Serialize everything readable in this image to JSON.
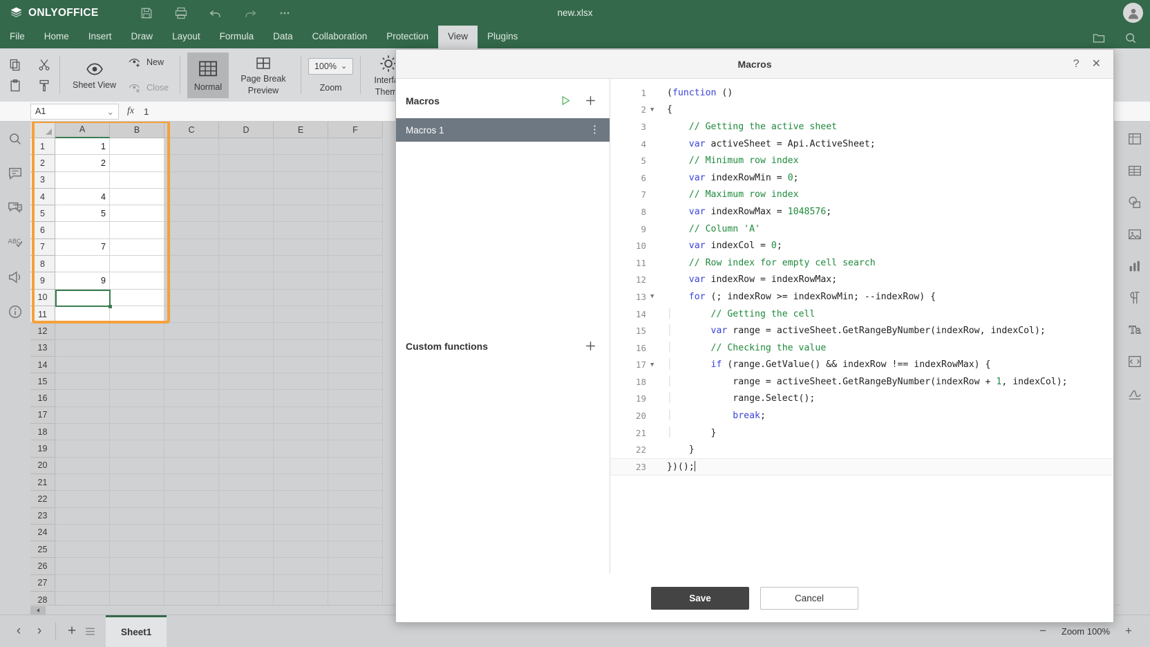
{
  "app": {
    "brand": "ONLYOFFICE",
    "document_title": "new.xlsx",
    "quick_icons": [
      "save-icon",
      "print-icon",
      "undo-icon",
      "redo-icon",
      "more-icon"
    ],
    "avatar": "user-avatar"
  },
  "tabs": [
    {
      "label": "File",
      "active": false
    },
    {
      "label": "Home",
      "active": false
    },
    {
      "label": "Insert",
      "active": false
    },
    {
      "label": "Draw",
      "active": false
    },
    {
      "label": "Layout",
      "active": false
    },
    {
      "label": "Formula",
      "active": false
    },
    {
      "label": "Data",
      "active": false
    },
    {
      "label": "Collaboration",
      "active": false
    },
    {
      "label": "Protection",
      "active": false
    },
    {
      "label": "View",
      "active": true
    },
    {
      "label": "Plugins",
      "active": false
    }
  ],
  "ribbon": {
    "clipboard": [
      "copy-icon",
      "cut-icon",
      "paste-icon",
      "format-painter-icon"
    ],
    "sheet_view": {
      "label": "Sheet View",
      "caret": "⌄"
    },
    "new_view": "New",
    "close_view": "Close",
    "normal": "Normal",
    "page_break_preview": "Page Break\nPreview",
    "page_break_line1": "Page Break",
    "page_break_line2": "Preview",
    "zoom_value": "100%",
    "zoom_caret": "⌄",
    "zoom_label": "Zoom",
    "interface_theme_line1": "Interfac",
    "interface_theme_line2": "Theme"
  },
  "formula_bar": {
    "name_box": "A1",
    "fx": "fx",
    "formula_value": "1"
  },
  "left_rail": [
    "search-icon",
    "comment-icon",
    "chat-icon",
    "spellcheck-icon",
    "feedback-icon",
    "about-icon"
  ],
  "right_rail": [
    "cell-settings-icon",
    "table-settings-icon",
    "shape-settings-icon",
    "image-settings-icon",
    "chart-settings-icon",
    "paragraph-settings-icon",
    "text-art-icon",
    "pivot-settings-icon",
    "signature-icon"
  ],
  "spreadsheet": {
    "columns": [
      "A",
      "B",
      "C",
      "D",
      "E",
      "F"
    ],
    "selected_column": "A",
    "rows": [
      {
        "num": "1",
        "A": "1",
        "B": "",
        "inbox": true
      },
      {
        "num": "2",
        "A": "2",
        "B": "",
        "inbox": true
      },
      {
        "num": "3",
        "A": "",
        "B": "",
        "inbox": true
      },
      {
        "num": "4",
        "A": "4",
        "B": "",
        "inbox": true
      },
      {
        "num": "5",
        "A": "5",
        "B": "",
        "inbox": true
      },
      {
        "num": "6",
        "A": "",
        "B": "",
        "inbox": true
      },
      {
        "num": "7",
        "A": "7",
        "B": "",
        "inbox": true
      },
      {
        "num": "8",
        "A": "",
        "B": "",
        "inbox": true
      },
      {
        "num": "9",
        "A": "9",
        "B": "",
        "inbox": true
      },
      {
        "num": "10",
        "A": "",
        "B": "",
        "inbox": true
      },
      {
        "num": "11",
        "A": "",
        "B": "",
        "inbox": true
      },
      {
        "num": "12",
        "A": "",
        "B": "",
        "inbox": false
      },
      {
        "num": "13",
        "A": "",
        "B": "",
        "inbox": false
      },
      {
        "num": "14",
        "A": "",
        "B": "",
        "inbox": false
      },
      {
        "num": "15",
        "A": "",
        "B": "",
        "inbox": false
      },
      {
        "num": "16",
        "A": "",
        "B": "",
        "inbox": false
      },
      {
        "num": "17",
        "A": "",
        "B": "",
        "inbox": false
      },
      {
        "num": "18",
        "A": "",
        "B": "",
        "inbox": false
      },
      {
        "num": "19",
        "A": "",
        "B": "",
        "inbox": false
      },
      {
        "num": "20",
        "A": "",
        "B": "",
        "inbox": false
      },
      {
        "num": "21",
        "A": "",
        "B": "",
        "inbox": false
      },
      {
        "num": "22",
        "A": "",
        "B": "",
        "inbox": false
      },
      {
        "num": "23",
        "A": "",
        "B": "",
        "inbox": false
      },
      {
        "num": "24",
        "A": "",
        "B": "",
        "inbox": false
      },
      {
        "num": "25",
        "A": "",
        "B": "",
        "inbox": false
      },
      {
        "num": "26",
        "A": "",
        "B": "",
        "inbox": false
      },
      {
        "num": "27",
        "A": "",
        "B": "",
        "inbox": false
      },
      {
        "num": "28",
        "A": "",
        "B": "",
        "inbox": false
      }
    ],
    "active_cell": "A10",
    "annotation_color": "#f5a03c"
  },
  "status_bar": {
    "prev": "‹",
    "next": "›",
    "add_sheet": "+",
    "sheet_list": "list-icon",
    "sheet_tabs": [
      {
        "label": "Sheet1",
        "active": true
      }
    ],
    "zoom_out": "−",
    "zoom_label": "Zoom 100%",
    "zoom_in": "+"
  },
  "dialog": {
    "title": "Macros",
    "help": "?",
    "close": "✕",
    "macros_panel": {
      "title": "Macros",
      "run_icon": "run-icon",
      "add_icon": "plus-icon",
      "items": [
        {
          "label": "Macros 1",
          "selected": true,
          "menu": "⋮"
        }
      ]
    },
    "custom_functions_panel": {
      "title": "Custom functions",
      "add_icon": "plus-icon"
    },
    "buttons": {
      "save": "Save",
      "cancel": "Cancel"
    },
    "code": {
      "active_line": 23,
      "lines": [
        {
          "n": "1",
          "fold": false,
          "tokens": [
            {
              "t": "(",
              "c": "p"
            },
            {
              "t": "function",
              "c": "kw"
            },
            {
              "t": " ()",
              "c": "p"
            }
          ]
        },
        {
          "n": "2",
          "fold": true,
          "tokens": [
            {
              "t": "{",
              "c": "p"
            }
          ]
        },
        {
          "n": "3",
          "fold": false,
          "tokens": [
            {
              "t": "    // Getting the active sheet",
              "c": "cm"
            }
          ]
        },
        {
          "n": "4",
          "fold": false,
          "tokens": [
            {
              "t": "    ",
              "c": "p"
            },
            {
              "t": "var",
              "c": "kw"
            },
            {
              "t": " activeSheet = Api.ActiveSheet;",
              "c": "p"
            }
          ]
        },
        {
          "n": "5",
          "fold": false,
          "tokens": [
            {
              "t": "    // Minimum row index",
              "c": "cm"
            }
          ]
        },
        {
          "n": "6",
          "fold": false,
          "tokens": [
            {
              "t": "    ",
              "c": "p"
            },
            {
              "t": "var",
              "c": "kw"
            },
            {
              "t": " indexRowMin = ",
              "c": "p"
            },
            {
              "t": "0",
              "c": "nm"
            },
            {
              "t": ";",
              "c": "p"
            }
          ]
        },
        {
          "n": "7",
          "fold": false,
          "tokens": [
            {
              "t": "    // Maximum row index",
              "c": "cm"
            }
          ]
        },
        {
          "n": "8",
          "fold": false,
          "tokens": [
            {
              "t": "    ",
              "c": "p"
            },
            {
              "t": "var",
              "c": "kw"
            },
            {
              "t": " indexRowMax = ",
              "c": "p"
            },
            {
              "t": "1048576",
              "c": "nm"
            },
            {
              "t": ";",
              "c": "p"
            }
          ]
        },
        {
          "n": "9",
          "fold": false,
          "tokens": [
            {
              "t": "    // Column 'A'",
              "c": "cm"
            }
          ]
        },
        {
          "n": "10",
          "fold": false,
          "tokens": [
            {
              "t": "    ",
              "c": "p"
            },
            {
              "t": "var",
              "c": "kw"
            },
            {
              "t": " indexCol = ",
              "c": "p"
            },
            {
              "t": "0",
              "c": "nm"
            },
            {
              "t": ";",
              "c": "p"
            }
          ]
        },
        {
          "n": "11",
          "fold": false,
          "tokens": [
            {
              "t": "    // Row index for empty cell search",
              "c": "cm"
            }
          ]
        },
        {
          "n": "12",
          "fold": false,
          "tokens": [
            {
              "t": "    ",
              "c": "p"
            },
            {
              "t": "var",
              "c": "kw"
            },
            {
              "t": " indexRow = indexRowMax;",
              "c": "p"
            }
          ]
        },
        {
          "n": "13",
          "fold": true,
          "tokens": [
            {
              "t": "    ",
              "c": "p"
            },
            {
              "t": "for",
              "c": "kw"
            },
            {
              "t": " (; indexRow >= indexRowMin; --indexRow) {",
              "c": "p"
            }
          ]
        },
        {
          "n": "14",
          "fold": false,
          "tokens": [
            {
              "t": "    ",
              "c": "gut"
            },
            {
              "t": "    // Getting the cell",
              "c": "cm"
            }
          ]
        },
        {
          "n": "15",
          "fold": false,
          "tokens": [
            {
              "t": "    ",
              "c": "gut"
            },
            {
              "t": "    ",
              "c": "p"
            },
            {
              "t": "var",
              "c": "kw"
            },
            {
              "t": " range = activeSheet.GetRangeByNumber(indexRow, indexCol);",
              "c": "p"
            }
          ]
        },
        {
          "n": "16",
          "fold": false,
          "tokens": [
            {
              "t": "    ",
              "c": "gut"
            },
            {
              "t": "    // Checking the value",
              "c": "cm"
            }
          ]
        },
        {
          "n": "17",
          "fold": true,
          "tokens": [
            {
              "t": "    ",
              "c": "gut"
            },
            {
              "t": "    ",
              "c": "p"
            },
            {
              "t": "if",
              "c": "kw"
            },
            {
              "t": " (range.GetValue() && indexRow !== indexRowMax) {",
              "c": "p"
            }
          ]
        },
        {
          "n": "18",
          "fold": false,
          "tokens": [
            {
              "t": "    ",
              "c": "gut"
            },
            {
              "t": "        range = activeSheet.GetRangeByNumber(indexRow + ",
              "c": "p"
            },
            {
              "t": "1",
              "c": "nm"
            },
            {
              "t": ", indexCol);",
              "c": "p"
            }
          ]
        },
        {
          "n": "19",
          "fold": false,
          "tokens": [
            {
              "t": "    ",
              "c": "gut"
            },
            {
              "t": "        range.Select();",
              "c": "p"
            }
          ]
        },
        {
          "n": "20",
          "fold": false,
          "tokens": [
            {
              "t": "    ",
              "c": "gut"
            },
            {
              "t": "        ",
              "c": "p"
            },
            {
              "t": "break",
              "c": "kw"
            },
            {
              "t": ";",
              "c": "p"
            }
          ]
        },
        {
          "n": "21",
          "fold": false,
          "tokens": [
            {
              "t": "    ",
              "c": "gut"
            },
            {
              "t": "    }",
              "c": "p"
            }
          ]
        },
        {
          "n": "22",
          "fold": false,
          "tokens": [
            {
              "t": "    }",
              "c": "p"
            }
          ]
        },
        {
          "n": "23",
          "fold": false,
          "tokens": [
            {
              "t": "})();",
              "c": "p"
            }
          ],
          "caret": true
        }
      ]
    }
  }
}
